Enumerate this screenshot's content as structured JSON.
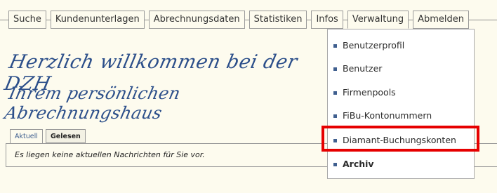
{
  "nav": {
    "items": [
      "Suche",
      "Kundenunterlagen",
      "Abrechnungsdaten",
      "Statistiken",
      "Infos",
      "Verwaltung",
      "Abmelden"
    ],
    "active": "Verwaltung"
  },
  "welcome": {
    "line1": "Herzlich willkommen bei der DZH",
    "line2": "Ihrem persönlichen Abrechnungshaus"
  },
  "dropdown": {
    "items": [
      {
        "label": "Benutzerprofil",
        "bold": false
      },
      {
        "label": "Benutzer",
        "bold": false
      },
      {
        "label": "Firmenpools",
        "bold": false
      },
      {
        "label": "FiBu-Kontonummern",
        "bold": false
      },
      {
        "label": "Diamant-Buchungskonten",
        "bold": false,
        "highlighted": true
      },
      {
        "label": "Archiv",
        "bold": true
      }
    ]
  },
  "tabs": {
    "items": [
      "Aktuell",
      "Gelesen"
    ],
    "active": "Aktuell"
  },
  "messages": {
    "empty_text": "Es liegen keine aktuellen Nachrichten für Sie vor."
  },
  "colors": {
    "background": "#fdfbee",
    "accent": "#3f5f8f",
    "highlight": "#e60000"
  }
}
